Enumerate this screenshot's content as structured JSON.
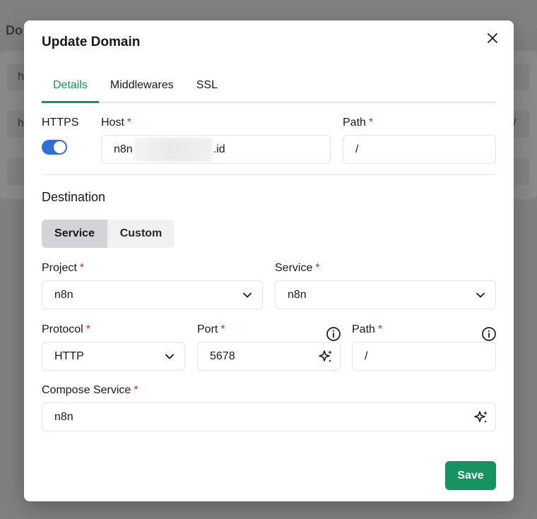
{
  "background": {
    "title_fragment": "Do",
    "row_letters": [
      "h",
      "h"
    ],
    "row_trailing": "/"
  },
  "dialog": {
    "title": "Update Domain",
    "close_icon": "close-icon",
    "tabs": [
      {
        "label": "Details",
        "active": true
      },
      {
        "label": "Middlewares",
        "active": false
      },
      {
        "label": "SSL",
        "active": false
      }
    ]
  },
  "details": {
    "https_label": "HTTPS",
    "https_enabled": true,
    "host_label": "Host",
    "host_value_prefix": "n8n",
    "host_value_suffix": ".id",
    "path_label": "Path",
    "path_value": "/",
    "required_mark": "*"
  },
  "destination": {
    "title": "Destination",
    "segments": [
      {
        "label": "Service",
        "active": true
      },
      {
        "label": "Custom",
        "active": false
      }
    ],
    "project_label": "Project",
    "project_value": "n8n",
    "service_label": "Service",
    "service_value": "n8n",
    "protocol_label": "Protocol",
    "protocol_value": "HTTP",
    "port_label": "Port",
    "port_value": "5678",
    "path_label": "Path",
    "path_value": "/",
    "compose_service_label": "Compose Service",
    "compose_service_value": "n8n"
  },
  "footer": {
    "save_label": "Save"
  },
  "colors": {
    "accent": "#16935f",
    "toggle": "#2f6fd6",
    "required": "#dc2626"
  }
}
